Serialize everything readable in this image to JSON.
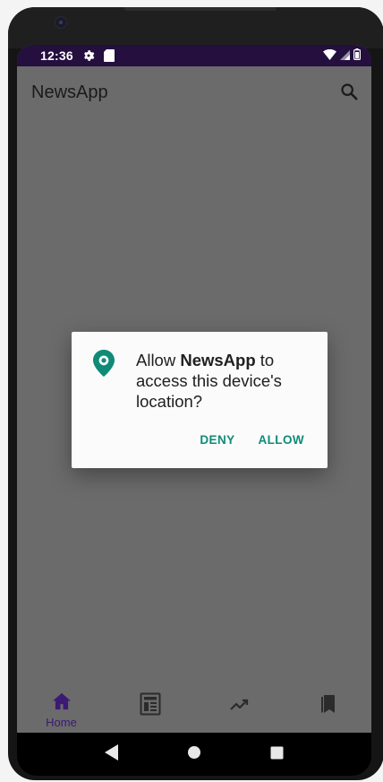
{
  "status_bar": {
    "time": "12:36",
    "icons": [
      "gear-icon",
      "sd-card-icon",
      "wifi-icon",
      "signal-icon",
      "battery-icon"
    ]
  },
  "app_bar": {
    "title": "NewsApp",
    "icon": "search-icon"
  },
  "dialog": {
    "prefix": "Allow ",
    "app_name": "NewsApp",
    "suffix": " to access this device's location?",
    "icon": "location-pin-icon",
    "deny_label": "DENY",
    "allow_label": "ALLOW"
  },
  "bottom_nav": {
    "items": [
      {
        "label": "Home",
        "icon": "home-icon",
        "active": true
      },
      {
        "label": "",
        "icon": "newspaper-icon",
        "active": false
      },
      {
        "label": "",
        "icon": "trending-icon",
        "active": false
      },
      {
        "label": "",
        "icon": "bookmarks-icon",
        "active": false
      }
    ]
  },
  "system_nav": {
    "icons": [
      "back-icon",
      "home-circle-icon",
      "recents-icon"
    ]
  },
  "colors": {
    "status_bar": "#240f3f",
    "scrim": "#6b6b6b",
    "accent": "#0f8b78",
    "nav_active": "#3b1a73"
  }
}
